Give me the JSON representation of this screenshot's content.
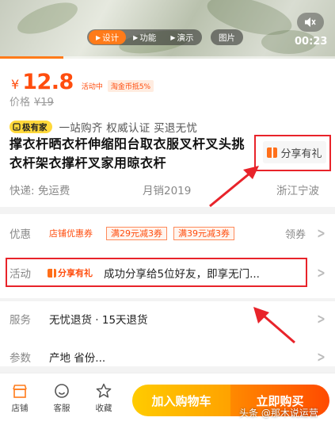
{
  "media": {
    "tabs": [
      {
        "label": "设计",
        "icon": "play-triangle-icon",
        "active": true
      },
      {
        "label": "功能",
        "icon": "play-triangle-icon",
        "active": false
      },
      {
        "label": "演示",
        "icon": "play-triangle-icon",
        "active": false
      }
    ],
    "picture_tab": "图片",
    "timer": "00:23",
    "mute_icon": "speaker-muted-icon",
    "progress": 0.19,
    "accent_color": "#ff7b1a"
  },
  "price": {
    "currency": "¥",
    "value": "12.8",
    "activity_tag": "活动中",
    "coin_tag": "淘金币抵5%",
    "original_label": "价格",
    "original_value": "¥19",
    "color": "#ff4d0e"
  },
  "brand": {
    "badge": "极有家",
    "slogan": "一站购齐 权威认证 买退无忧"
  },
  "product": {
    "title": "撑衣杆晒衣杆伸缩阳台取衣服叉杆叉头挑衣杆架衣撑杆叉家用晾衣杆",
    "share_label": "分享有礼",
    "shipping": "快递: 免运费",
    "monthly_sales": "月销2019",
    "location": "浙江宁波"
  },
  "details": {
    "discount_label": "优惠",
    "shop_coupon": "店铺优惠券",
    "coupons": [
      "满29元减3券",
      "满39元减3券"
    ],
    "claim_label": "领券",
    "activity_label": "活动",
    "activity_tag": "分享有礼",
    "activity_text": "成功分享给5位好友，即享无门...",
    "service_label": "服务",
    "service_text": "无忧退货 · 15天退货",
    "param_label": "参数",
    "param_text": "产地 省份..."
  },
  "bottom": {
    "nav": [
      {
        "label": "店铺",
        "icon": "shop-icon"
      },
      {
        "label": "客服",
        "icon": "customer-service-icon"
      },
      {
        "label": "收藏",
        "icon": "star-icon"
      }
    ],
    "add_cart": "加入购物车",
    "buy_now": "立即购买"
  },
  "watermark": "头条 @那木说运营",
  "highlight_color": "#e8232a"
}
